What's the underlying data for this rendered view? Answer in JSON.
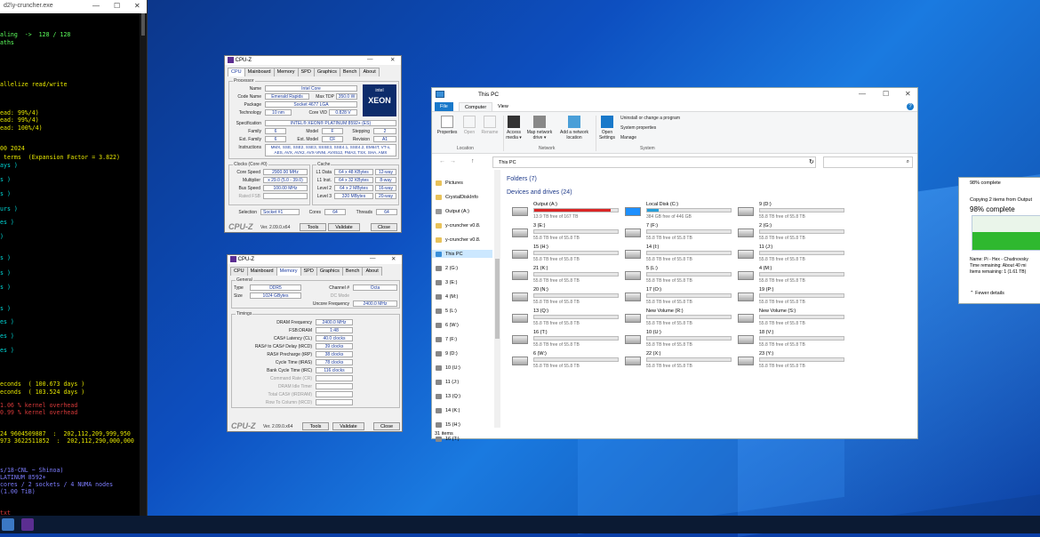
{
  "terminal": {
    "title": "d2\\y-cruncher.exe",
    "lines": [
      {
        "text": "aling  ->  128 / 128",
        "color": "#5cff5c"
      },
      {
        "text": "aths",
        "color": "#5cff5c"
      },
      {
        "text": "allelize read/write",
        "color": "#e6e600"
      },
      {
        "text": "ead: 99%/4)",
        "color": "#e6e600"
      },
      {
        "text": "ead: 99%/4)",
        "color": "#e6e600"
      },
      {
        "text": "ead: 100%/4)",
        "color": "#e6e600"
      },
      {
        "text": "00 2024",
        "color": "#e6e600"
      },
      {
        "text": " terms  (Expansion Factor = 3.822)",
        "color": "#e6e600"
      },
      {
        "text": "ays )",
        "color": "#00d7d7"
      },
      {
        "text": "s )",
        "color": "#00d7d7"
      },
      {
        "text": "s )",
        "color": "#00d7d7"
      },
      {
        "text": "urs )",
        "color": "#00d7d7"
      },
      {
        "text": "es )",
        "color": "#00d7d7"
      },
      {
        "text": ")",
        "color": "#00d7d7"
      },
      {
        "text": "s )",
        "color": "#00d7d7"
      },
      {
        "text": "s )",
        "color": "#00d7d7"
      },
      {
        "text": "s )",
        "color": "#00d7d7"
      },
      {
        "text": "s )",
        "color": "#00d7d7"
      },
      {
        "text": "es )",
        "color": "#00d7d7"
      },
      {
        "text": "es )",
        "color": "#00d7d7"
      },
      {
        "text": "es )",
        "color": "#00d7d7"
      },
      {
        "text": "econds  ( 100.673 days )",
        "color": "#e6e600"
      },
      {
        "text": "econds  ( 103.524 days )",
        "color": "#e6e600"
      },
      {
        "text": "1.06 % kernel overhead",
        "color": "#d93a3a"
      },
      {
        "text": "0.99 % kernel overhead",
        "color": "#d93a3a"
      },
      {
        "text": "24 9604509887  :  202,112,209,999,950",
        "color": "#e6e600"
      },
      {
        "text": "973 3622511852  :  202,112,290,000,000",
        "color": "#e6e600"
      },
      {
        "text": "s/18-CNL ~ Shinoa)",
        "color": "#7d7dff"
      },
      {
        "text": "LATINUM 8592+",
        "color": "#7d7dff"
      },
      {
        "text": "cores / 2 sockets / 4 NUMA nodes",
        "color": "#7d7dff"
      },
      {
        "text": "(1.00 TiB)",
        "color": "#7d7dff"
      },
      {
        "text": "txt",
        "color": "#d93a3a"
      }
    ]
  },
  "cpuz1": {
    "title": "CPU-Z",
    "tabs": [
      "CPU",
      "Mainboard",
      "Memory",
      "SPD",
      "Graphics",
      "Bench",
      "About"
    ],
    "processor_label": "Processor",
    "name": "Intel Core",
    "codename": "Emerald Rapids",
    "max_tdp": "350.0 W",
    "package": "Socket 4677 LGA",
    "technology": "10 nm",
    "core_vid": "0.828 V",
    "specification": "INTEL® XEON® PLATINUM 8592+ (ES)",
    "family": "6",
    "model": "F",
    "stepping": "2",
    "ext_family": "6",
    "ext_model": "CF",
    "revision": "A1",
    "instructions": "MMX, SSE, SSE2, SSE3, SSSE3, SSE4.1, SSE4.2, EM64T, VT-x, AES, AVX, AVX2, AVX-VNNI, AVX512, FMA3, TSX, SHA, AMX",
    "clocks_label": "Clocks (Core #0)",
    "core_speed": "2900.00 MHz",
    "multiplier": "x 29.0 (5.0 - 39.0)",
    "bus_speed": "100.00 MHz",
    "rated_fsb": "Rated FSB",
    "cache_label": "Cache",
    "l1d": "64 x 48 KBytes",
    "l1d_way": "12-way",
    "l1i": "64 x 32 KBytes",
    "l1i_way": "8-way",
    "l2": "64 x 2 MBytes",
    "l2_way": "16-way",
    "l3": "320 MBytes",
    "l3_way": "20-way",
    "selection_label": "Selection",
    "socket": "Socket #1",
    "cores": "64",
    "threads": "64",
    "version": "Ver. 2.09.0.x64",
    "tools": "Tools",
    "validate": "Validate",
    "close": "Close",
    "logo": "CPU-Z",
    "badge": "XEON",
    "lbl": {
      "name": "Name",
      "codename": "Code Name",
      "maxtdp": "Max TDP",
      "package": "Package",
      "technology": "Technology",
      "corevid": "Core VID",
      "spec": "Specification",
      "family": "Family",
      "model": "Model",
      "stepping": "Stepping",
      "extfam": "Ext. Family",
      "extmod": "Ext. Model",
      "revision": "Revision",
      "instr": "Instructions",
      "corespeed": "Core Speed",
      "mult": "Multiplier",
      "bus": "Bus Speed",
      "l1d": "L1 Data",
      "l1i": "L1 Inst.",
      "l2": "Level 2",
      "l3": "Level 3",
      "cores": "Cores",
      "threads": "Threads",
      "intel": "intel"
    }
  },
  "cpuz2": {
    "title": "CPU-Z",
    "tabs": [
      "CPU",
      "Mainboard",
      "Memory",
      "SPD",
      "Graphics",
      "Bench",
      "About"
    ],
    "general_label": "General",
    "type": "DDR5",
    "size": "1024 GBytes",
    "channel": "Octa",
    "dc_mode": "DC Mode",
    "uncore": "2400.0 MHz",
    "timings_label": "Timings",
    "dram_freq": "2400.0 MHz",
    "fsb_dram": "1:48",
    "cas": "40.0 clocks",
    "rcd": "39 clocks",
    "rp": "38 clocks",
    "ras": "78 clocks",
    "rc": "116 clocks",
    "version": "Ver. 2.09.0.x64",
    "tools": "Tools",
    "validate": "Validate",
    "close": "Close",
    "logo": "CPU-Z",
    "lbl": {
      "type": "Type",
      "size": "Size",
      "channel": "Channel #",
      "uncore": "Uncore Frequency",
      "dramfreq": "DRAM Frequency",
      "fsbdram": "FSB:DRAM",
      "cas": "CAS# Latency (CL)",
      "rcd": "RAS# to CAS# Delay (tRCD)",
      "rp": "RAS# Precharge (tRP)",
      "ras": "Cycle Time (tRAS)",
      "rc": "Bank Cycle Time (tRC)",
      "cr": "Command Rate (CR)",
      "idle": "DRAM Idle Timer",
      "total": "Total CAS# (tRDRAM)",
      "rowcol": "Row To Column (tRCD)"
    }
  },
  "explorer": {
    "title": "This PC",
    "tabs": [
      "File",
      "Computer",
      "View"
    ],
    "ribbon": [
      {
        "label": "Properties"
      },
      {
        "label": "Open"
      },
      {
        "label": "Rename"
      },
      {
        "label": "Access media ▾"
      },
      {
        "label": "Map network drive ▾"
      },
      {
        "label": "Add a network location"
      },
      {
        "label": "Open Settings"
      }
    ],
    "sys_items": [
      "Uninstall or change a program",
      "System properties",
      "Manage"
    ],
    "groups": [
      "Location",
      "Network",
      "System"
    ],
    "address": "This PC",
    "folders": "Folders (7)",
    "devices": "Devices and drives (24)",
    "nav": [
      "Pictures",
      "CrystalDiskInfo",
      "Output (A:)",
      "y-cruncher v0.8.",
      "y-cruncher v0.8.",
      "This PC",
      "2 (G:)",
      "3 (E:)",
      "4 (M:)",
      "5 (L:)",
      "6 (W:)",
      "7 (F:)",
      "9 (D:)",
      "10 (U:)",
      "11 (J:)",
      "13 (Q:)",
      "14 (K:)",
      "15 (H:)",
      "16 (T:)"
    ],
    "drives": [
      {
        "name": "Output (A:)",
        "free": "13.9 TB free of 167 TB",
        "fill": 0.92,
        "color": "#da2626"
      },
      {
        "name": "Local Disk (C:)",
        "free": "384 GB free of 446 GB",
        "fill": 0.14,
        "color": "#26a0da"
      },
      {
        "name": "9 (D:)",
        "free": "55.8 TB free of 55.8 TB",
        "fill": 0,
        "color": "#26a0da"
      },
      {
        "name": "3 (E:)",
        "free": "55.8 TB free of 55.8 TB",
        "fill": 0,
        "color": "#26a0da"
      },
      {
        "name": "7 (F:)",
        "free": "55.8 TB free of 55.8 TB",
        "fill": 0,
        "color": "#26a0da"
      },
      {
        "name": "2 (G:)",
        "free": "55.8 TB free of 55.8 TB",
        "fill": 0,
        "color": "#26a0da"
      },
      {
        "name": "15 (H:)",
        "free": "55.8 TB free of 55.8 TB",
        "fill": 0,
        "color": "#26a0da"
      },
      {
        "name": "14 (I:)",
        "free": "55.8 TB free of 55.8 TB",
        "fill": 0,
        "color": "#26a0da"
      },
      {
        "name": "11 (J:)",
        "free": "55.8 TB free of 55.8 TB",
        "fill": 0,
        "color": "#26a0da"
      },
      {
        "name": "21 (K:)",
        "free": "55.8 TB free of 55.8 TB",
        "fill": 0,
        "color": "#26a0da"
      },
      {
        "name": "5 (L:)",
        "free": "55.8 TB free of 55.8 TB",
        "fill": 0,
        "color": "#26a0da"
      },
      {
        "name": "4 (M:)",
        "free": "55.8 TB free of 55.8 TB",
        "fill": 0,
        "color": "#26a0da"
      },
      {
        "name": "20 (N:)",
        "free": "55.8 TB free of 55.8 TB",
        "fill": 0,
        "color": "#26a0da"
      },
      {
        "name": "17 (O:)",
        "free": "55.8 TB free of 55.8 TB",
        "fill": 0,
        "color": "#26a0da"
      },
      {
        "name": "19 (P:)",
        "free": "55.8 TB free of 55.8 TB",
        "fill": 0,
        "color": "#26a0da"
      },
      {
        "name": "13 (Q:)",
        "free": "55.8 TB free of 55.8 TB",
        "fill": 0,
        "color": "#26a0da"
      },
      {
        "name": "New Volume (R:)",
        "free": "55.8 TB free of 55.8 TB",
        "fill": 0,
        "color": "#26a0da"
      },
      {
        "name": "New Volume (S:)",
        "free": "55.8 TB free of 55.8 TB",
        "fill": 0,
        "color": "#26a0da"
      },
      {
        "name": "16 (T:)",
        "free": "55.8 TB free of 55.8 TB",
        "fill": 0,
        "color": "#26a0da"
      },
      {
        "name": "10 (U:)",
        "free": "55.8 TB free of 55.8 TB",
        "fill": 0,
        "color": "#26a0da"
      },
      {
        "name": "18 (V:)",
        "free": "55.8 TB free of 55.8 TB",
        "fill": 0,
        "color": "#26a0da"
      },
      {
        "name": "6 (W:)",
        "free": "55.8 TB free of 55.8 TB",
        "fill": 0,
        "color": "#26a0da"
      },
      {
        "name": "22 (X:)",
        "free": "55.8 TB free of 55.8 TB",
        "fill": 0,
        "color": "#26a0da"
      },
      {
        "name": "23 (Y:)",
        "free": "55.8 TB free of 55.8 TB",
        "fill": 0,
        "color": "#26a0da"
      }
    ],
    "status": "31 items"
  },
  "copy": {
    "title": "98% complete",
    "line": "Copying 2 items from Output",
    "pct": "98% complete",
    "progress": 0.98,
    "name": "Name:  Pi - Hex - Chudnovsky",
    "time": "Time remaining:  About 40 mi",
    "items": "Items remaining:  1 (1.61 TB)",
    "fewer": "Fewer details"
  }
}
